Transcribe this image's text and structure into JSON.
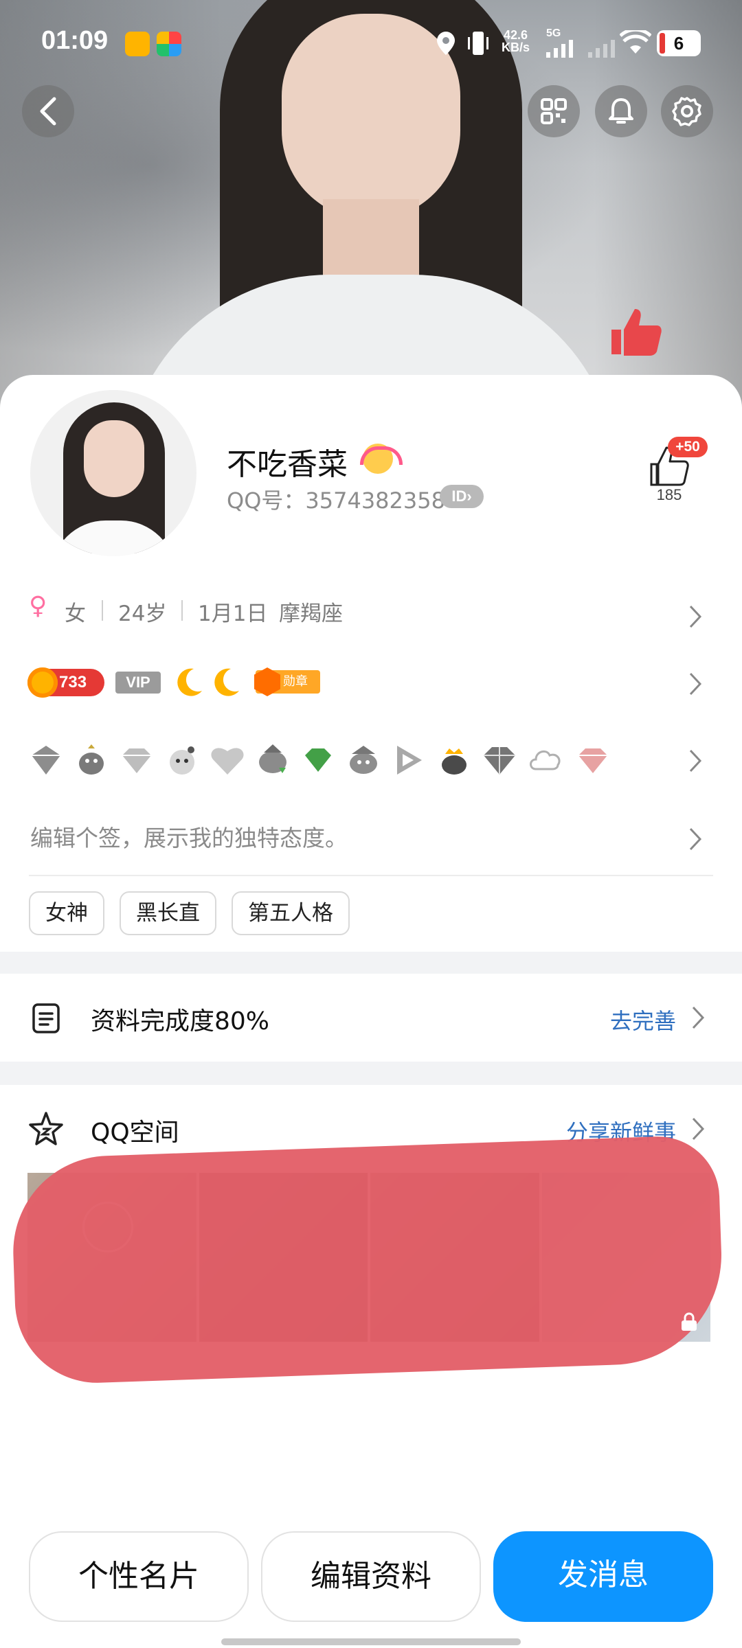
{
  "status_bar": {
    "time": "01:09",
    "net_speed": "42.6",
    "net_unit": "KB/s",
    "net_type": "5G",
    "battery": "6"
  },
  "profile": {
    "name": "不吃香菜",
    "qq_number": "QQ号：3574382358",
    "id_badge": "ID",
    "like_plus": "+50",
    "like_count": "185"
  },
  "info": {
    "gender": "女",
    "age": "24岁",
    "birthday": "1月1日",
    "zodiac": "摩羯座"
  },
  "badges": {
    "level": "733",
    "vip": "VIP",
    "medal": "勋章"
  },
  "signature_placeholder": "编辑个签，展示我的独特态度。",
  "tags": [
    "女神",
    "黑长直",
    "第五人格"
  ],
  "completeness": {
    "title": "资料完成度80%",
    "link": "去完善"
  },
  "qzone": {
    "title": "QQ空间",
    "link": "分享新鲜事"
  },
  "buttons": {
    "card": "个性名片",
    "edit": "编辑资料",
    "message": "发消息"
  },
  "colors": {
    "accent": "#0d95ff",
    "link": "#2f6fbf",
    "like_badge": "#f0463c",
    "gender": "#ff6fa1"
  }
}
